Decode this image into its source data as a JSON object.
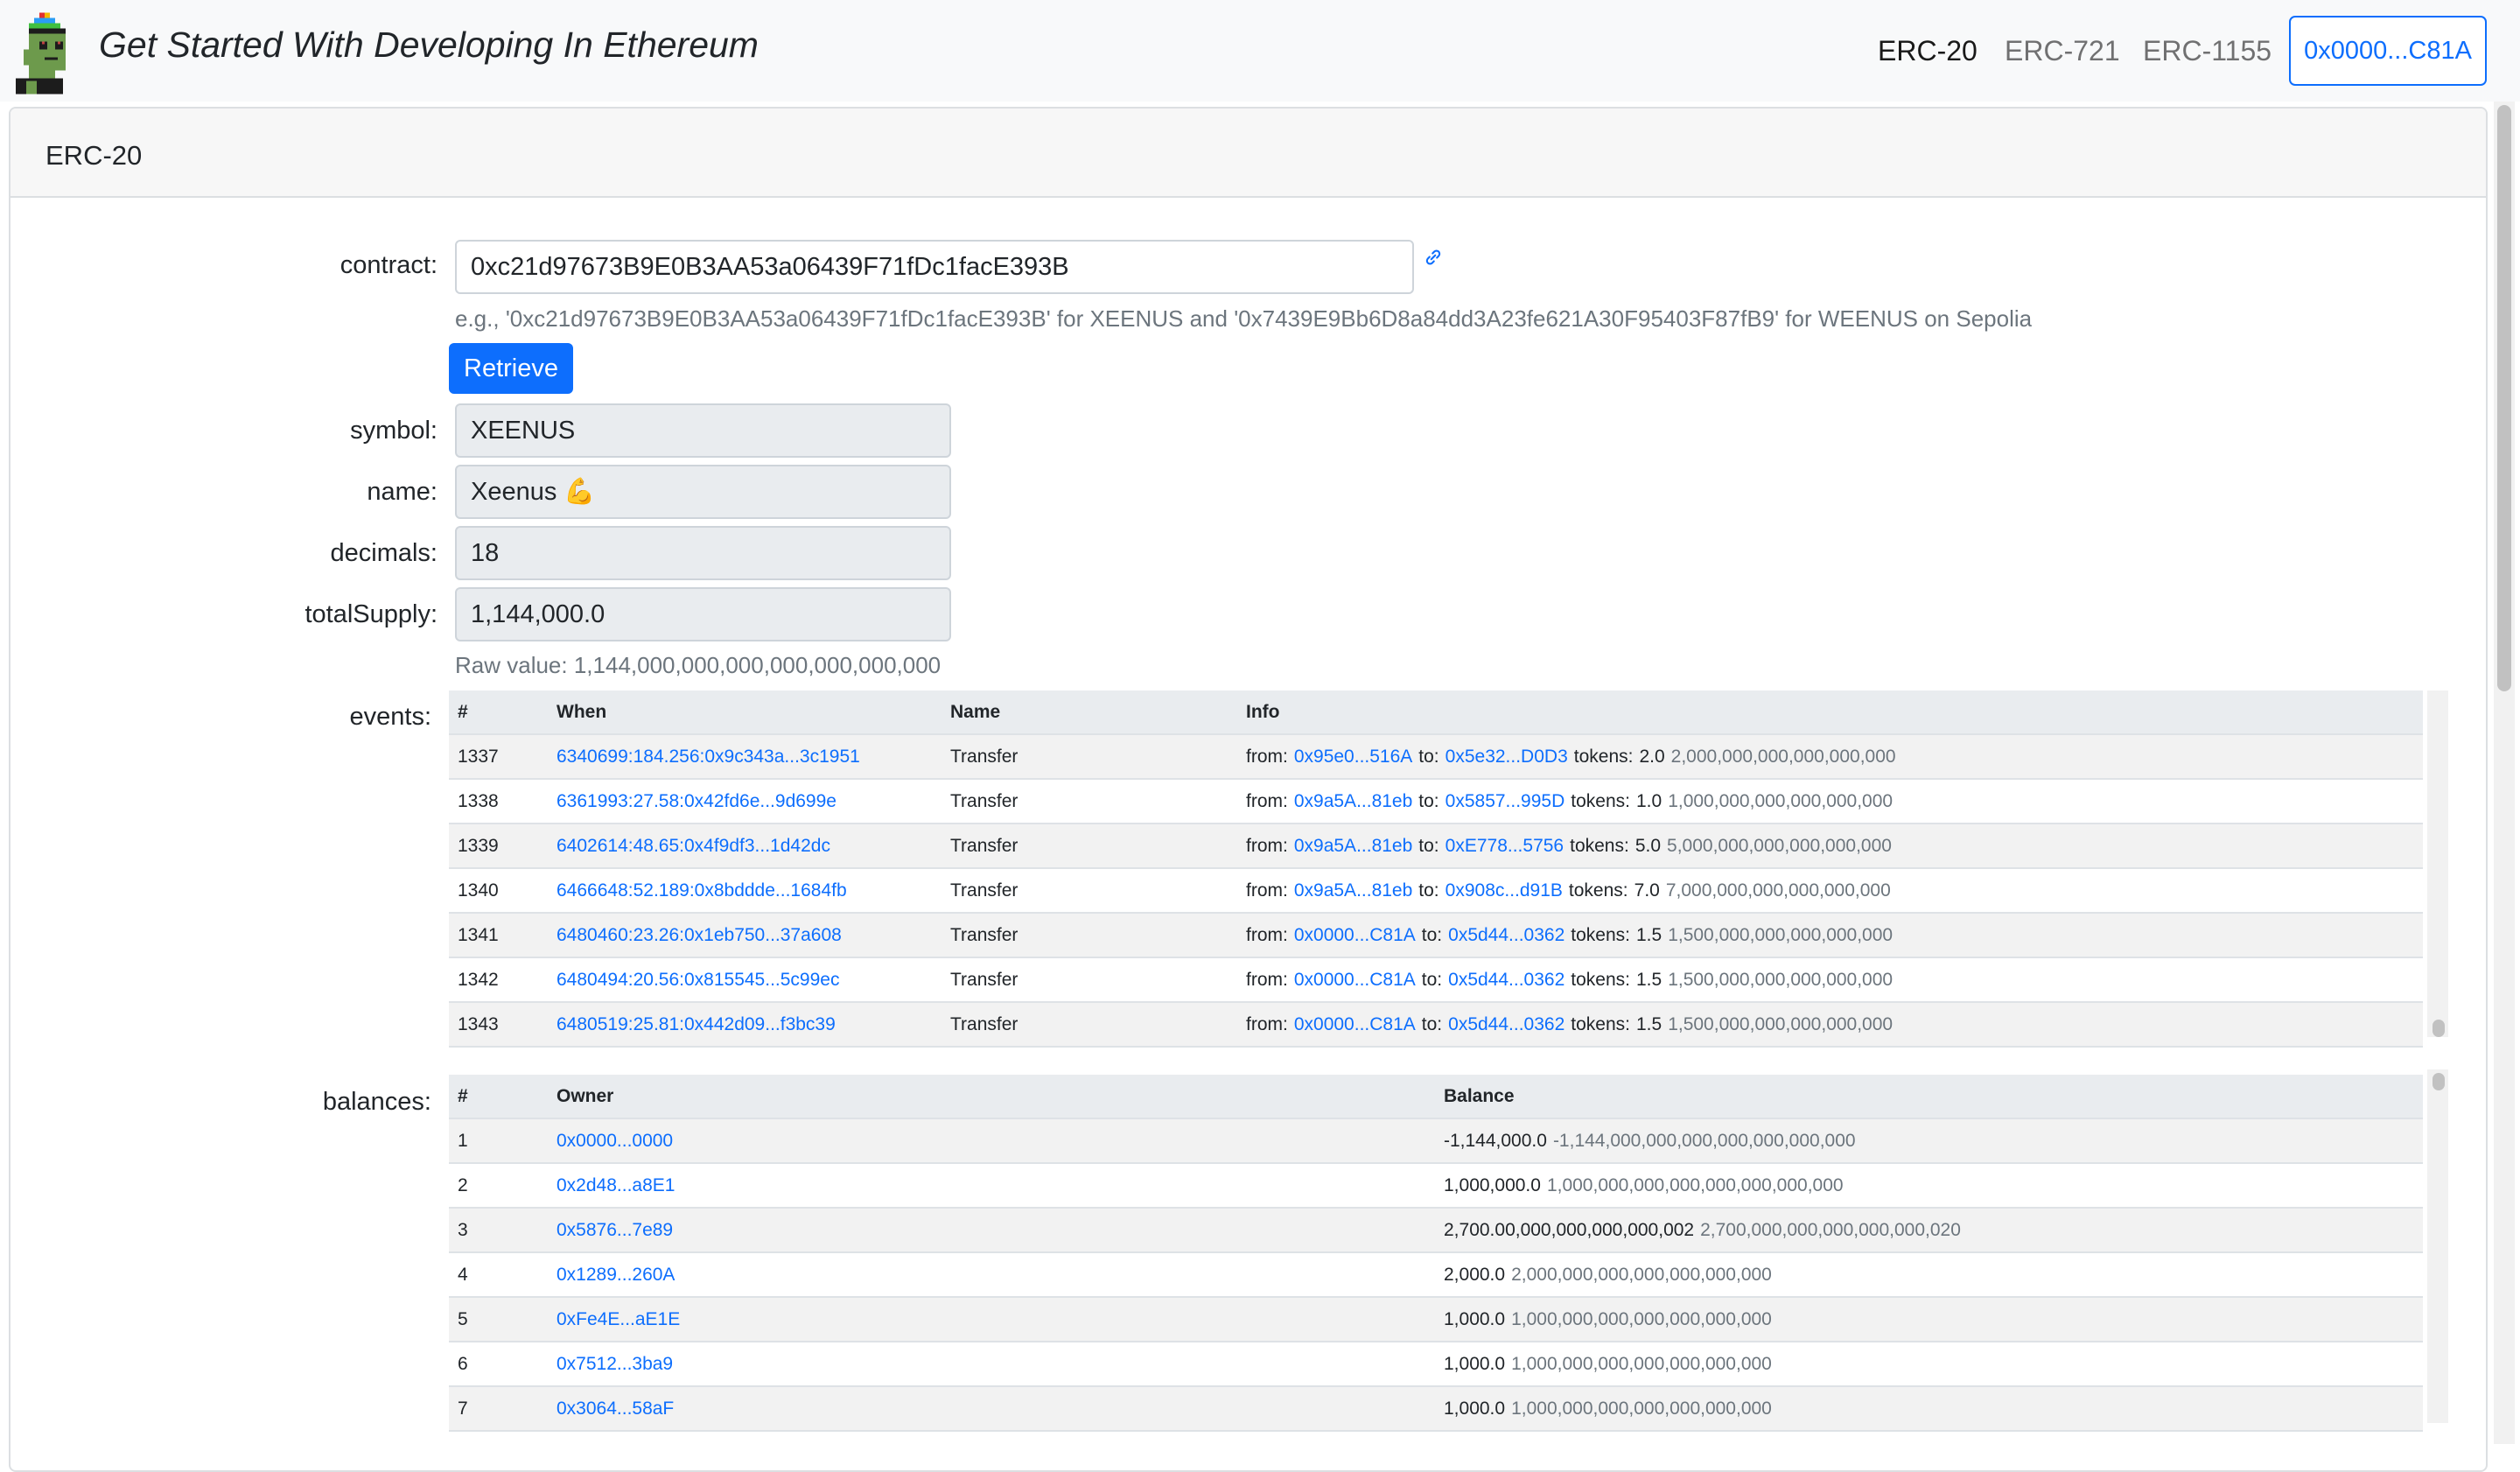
{
  "navbar": {
    "brand": "Get Started With Developing In Ethereum",
    "links": [
      "ERC-20",
      "ERC-721",
      "ERC-1155"
    ],
    "account_button": "0x0000...C81A"
  },
  "card": {
    "title": "ERC-20"
  },
  "form": {
    "contract_label": "contract:",
    "contract_value": "0xc21d97673B9E0B3AA53a06439F71fDc1facE393B",
    "contract_hint": "e.g., '0xc21d97673B9E0B3AA53a06439F71fDc1facE393B' for XEENUS and '0x7439E9Bb6D8a84dd3A23fe621A30F95403F87fB9' for WEENUS on Sepolia",
    "retrieve_label": "Retrieve",
    "symbol_label": "symbol:",
    "symbol_value": "XEENUS",
    "name_label": "name:",
    "name_value": "Xeenus 💪",
    "decimals_label": "decimals:",
    "decimals_value": "18",
    "total_supply_label": "totalSupply:",
    "total_supply_value": "1,144,000.0",
    "raw_value_text": "Raw value: 1,144,000,000,000,000,000,000,000"
  },
  "events": {
    "label": "events:",
    "headers": [
      "#",
      "When",
      "Name",
      "Info"
    ],
    "rows": [
      {
        "num": "1337",
        "when": "6340699:184.256:0x9c343a...3c1951",
        "name": "Transfer",
        "from_label": "from:",
        "from": "0x95e0...516A",
        "to_label": "to:",
        "to": "0x5e32...D0D3",
        "tokens_label": "tokens:",
        "tokens": "2.0",
        "raw": "2,000,000,000,000,000,000"
      },
      {
        "num": "1338",
        "when": "6361993:27.58:0x42fd6e...9d699e",
        "name": "Transfer",
        "from_label": "from:",
        "from": "0x9a5A...81eb",
        "to_label": "to:",
        "to": "0x5857...995D",
        "tokens_label": "tokens:",
        "tokens": "1.0",
        "raw": "1,000,000,000,000,000,000"
      },
      {
        "num": "1339",
        "when": "6402614:48.65:0x4f9df3...1d42dc",
        "name": "Transfer",
        "from_label": "from:",
        "from": "0x9a5A...81eb",
        "to_label": "to:",
        "to": "0xE778...5756",
        "tokens_label": "tokens:",
        "tokens": "5.0",
        "raw": "5,000,000,000,000,000,000"
      },
      {
        "num": "1340",
        "when": "6466648:52.189:0x8bddde...1684fb",
        "name": "Transfer",
        "from_label": "from:",
        "from": "0x9a5A...81eb",
        "to_label": "to:",
        "to": "0x908c...d91B",
        "tokens_label": "tokens:",
        "tokens": "7.0",
        "raw": "7,000,000,000,000,000,000"
      },
      {
        "num": "1341",
        "when": "6480460:23.26:0x1eb750...37a608",
        "name": "Transfer",
        "from_label": "from:",
        "from": "0x0000...C81A",
        "to_label": "to:",
        "to": "0x5d44...0362",
        "tokens_label": "tokens:",
        "tokens": "1.5",
        "raw": "1,500,000,000,000,000,000"
      },
      {
        "num": "1342",
        "when": "6480494:20.56:0x815545...5c99ec",
        "name": "Transfer",
        "from_label": "from:",
        "from": "0x0000...C81A",
        "to_label": "to:",
        "to": "0x5d44...0362",
        "tokens_label": "tokens:",
        "tokens": "1.5",
        "raw": "1,500,000,000,000,000,000"
      },
      {
        "num": "1343",
        "when": "6480519:25.81:0x442d09...f3bc39",
        "name": "Transfer",
        "from_label": "from:",
        "from": "0x0000...C81A",
        "to_label": "to:",
        "to": "0x5d44...0362",
        "tokens_label": "tokens:",
        "tokens": "1.5",
        "raw": "1,500,000,000,000,000,000"
      }
    ]
  },
  "balances": {
    "label": "balances:",
    "headers": [
      "#",
      "Owner",
      "Balance"
    ],
    "rows": [
      {
        "num": "1",
        "owner": "0x0000...0000",
        "balance": "-1,144,000.0",
        "raw": "-1,144,000,000,000,000,000,000,000"
      },
      {
        "num": "2",
        "owner": "0x2d48...a8E1",
        "balance": "1,000,000.0",
        "raw": "1,000,000,000,000,000,000,000,000"
      },
      {
        "num": "3",
        "owner": "0x5876...7e89",
        "balance": "2,700.00,000,000,000,000,002",
        "raw": "2,700,000,000,000,000,000,020"
      },
      {
        "num": "4",
        "owner": "0x1289...260A",
        "balance": "2,000.0",
        "raw": "2,000,000,000,000,000,000,000"
      },
      {
        "num": "5",
        "owner": "0xFe4E...aE1E",
        "balance": "1,000.0",
        "raw": "1,000,000,000,000,000,000,000"
      },
      {
        "num": "6",
        "owner": "0x7512...3ba9",
        "balance": "1,000.0",
        "raw": "1,000,000,000,000,000,000,000"
      },
      {
        "num": "7",
        "owner": "0x3064...58aF",
        "balance": "1,000.0",
        "raw": "1,000,000,000,000,000,000,000"
      }
    ]
  },
  "colors": {
    "primary": "#0d6efd",
    "navbar_bg": "#f8f9fa",
    "stripe": "#f2f2f2"
  }
}
